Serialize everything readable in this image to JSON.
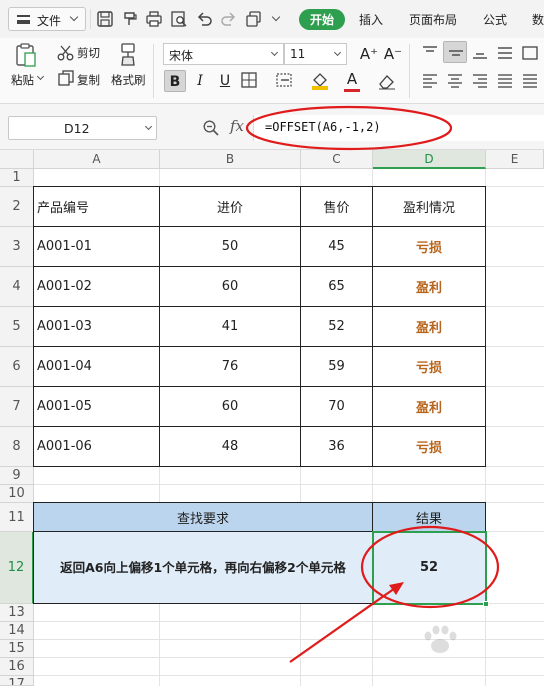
{
  "menubar": {
    "file_label": "文件",
    "tabs": [
      {
        "label": "开始",
        "active": true
      },
      {
        "label": "插入"
      },
      {
        "label": "页面布局"
      },
      {
        "label": "公式"
      },
      {
        "label": "数"
      }
    ],
    "quick_access_icons": [
      "save-icon",
      "format-painter-quick-icon",
      "print-icon",
      "print-preview-icon",
      "undo-icon",
      "redo-icon",
      "copy-window-icon",
      "dropdown-icon"
    ]
  },
  "ribbon": {
    "cut_label": "剪切",
    "copy_label": "复制",
    "paste_label": "粘贴",
    "format_painter_label": "格式刷",
    "font_name": "宋体",
    "font_size": "11",
    "grow_font": "A⁺",
    "shrink_font": "A⁻",
    "bold": "B",
    "italic": "I",
    "underline": "U",
    "font_color_letter": "A",
    "font_color": "#d9252a",
    "fill_color": "#f0c000"
  },
  "formula_bar": {
    "name_box": "D12",
    "fx": "fx",
    "formula": "=OFFSET(A6,-1,2)"
  },
  "sheet": {
    "active_column": "D",
    "active_row": "12",
    "columns": [
      "A",
      "B",
      "C",
      "D",
      "E"
    ],
    "rows": [
      "1",
      "2",
      "3",
      "4",
      "5",
      "6",
      "7",
      "8",
      "9",
      "10",
      "11",
      "12",
      "13",
      "14",
      "15",
      "16",
      "17"
    ],
    "table": {
      "headers": [
        "产品编号",
        "进价",
        "售价",
        "盈利情况"
      ],
      "rows": [
        [
          "A001-01",
          "50",
          "45",
          "亏损"
        ],
        [
          "A001-02",
          "60",
          "65",
          "盈利"
        ],
        [
          "A001-03",
          "41",
          "52",
          "盈利"
        ],
        [
          "A001-04",
          "76",
          "59",
          "亏损"
        ],
        [
          "A001-05",
          "60",
          "70",
          "盈利"
        ],
        [
          "A001-06",
          "48",
          "36",
          "亏损"
        ]
      ]
    },
    "lookup": {
      "header_request": "查找要求",
      "header_result": "结果",
      "description": "返回A6向上偏移1个单元格，再向右偏移2个单元格",
      "result": "52"
    },
    "colors": {
      "status_text": "#b8651d",
      "annotation": "#e01b1b",
      "header_fill": "#bcd5ee",
      "body_fill": "#e0ecf8",
      "selection": "#2e9e4f"
    }
  }
}
